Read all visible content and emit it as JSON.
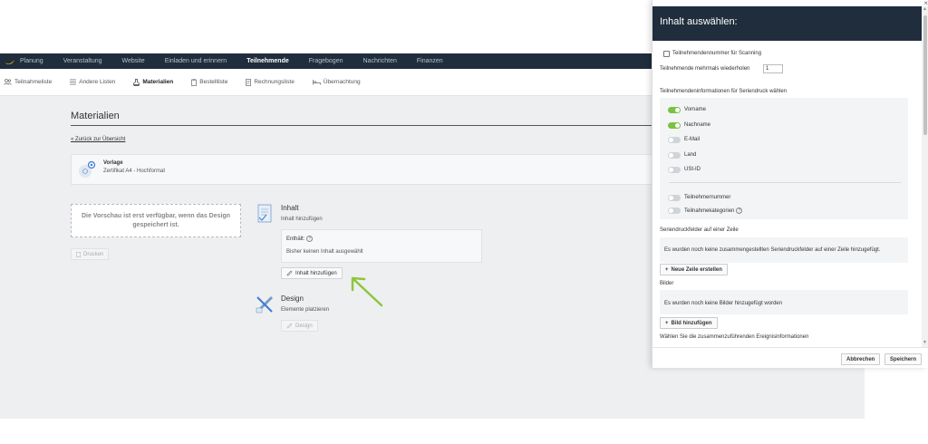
{
  "topnav": {
    "items": [
      "Planung",
      "Veranstaltung",
      "Website",
      "Einladen und erinnern",
      "Teilnehmende",
      "Fragebogen",
      "Nachrichten",
      "Finanzen"
    ],
    "active": "Teilnehmende"
  },
  "subnav": {
    "items": [
      "Teilnahmeliste",
      "Andere Listen",
      "Materialien",
      "Bestellliste",
      "Rechnungsliste",
      "Übernachtung"
    ],
    "active": "Materialien"
  },
  "main": {
    "title": "Materialien",
    "back_link": "« Zurück zur Übersicht",
    "template": {
      "label": "Vorlage",
      "name": "Zertifikat A4 - Hochformat"
    },
    "preview_text": "Die Vorschau ist erst verfügbar, wenn das Design gespeichert ist.",
    "print_button": "Drucken",
    "content_section": {
      "title": "Inhalt",
      "subtitle": "Inhalt hinzufügen",
      "contains_label": "Enthält:",
      "contains_value": "Bisher keinen Inhalt ausgewählt",
      "add_button": "Inhalt hinzufügen"
    },
    "design_section": {
      "title": "Design",
      "subtitle": "Elemente platzieren",
      "button": "Design"
    }
  },
  "modal": {
    "title": "Inhalt auswählen:",
    "scan_checkbox": "Teilnehmendennummer für Scanning",
    "repeat_label": "Teilnehmende mehrmals wiederholen",
    "repeat_value": "1",
    "info_heading": "Teilnehmendeninformationen für Seriendruck wählen",
    "toggles": [
      {
        "label": "Vorname",
        "on": true
      },
      {
        "label": "Nachname",
        "on": true
      },
      {
        "label": "E-Mail",
        "on": false
      },
      {
        "label": "Land",
        "on": false
      },
      {
        "label": "USt-ID",
        "on": false
      }
    ],
    "toggles2": [
      {
        "label": "Teilnehmernummer",
        "on": false
      },
      {
        "label": "Teilnahmekategorien",
        "on": false
      }
    ],
    "merge_fields_heading": "Seriendruckfelder auf einer Zeile",
    "merge_fields_empty": "Es wurden noch keine zusammengestellten Seriendruckfelder auf einer Zeile hinzugefügt.",
    "new_row_button": "Neue Zeile erstellen",
    "images_heading": "Bilder",
    "images_empty": "Es wurden noch keine Bilder hinzugefügt worden",
    "add_image_button": "Bild hinzufügen",
    "event_info_heading": "Wählen Sie die zusammenzuführenden Ereignisinformationen",
    "cancel_button": "Abbrechen",
    "save_button": "Speichern",
    "close_glyph": "×"
  },
  "colors": {
    "nav_bg": "#1f2d3d",
    "toggle_on": "#7cc242",
    "arrow": "#8cc63f"
  }
}
